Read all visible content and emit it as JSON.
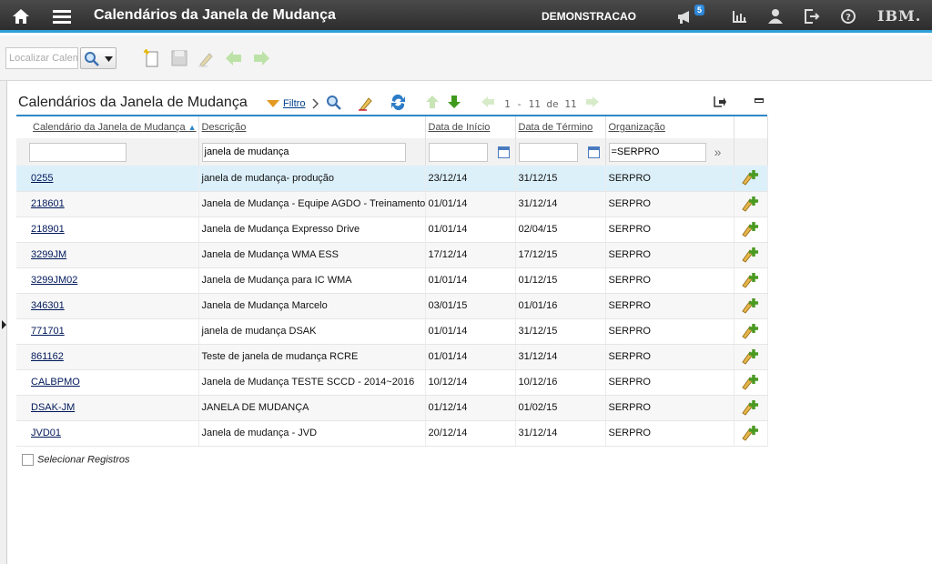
{
  "header": {
    "title": "Calendários da Janela de Mudança",
    "user": "DEMONSTRACAO",
    "notifications": "5",
    "brand": "IBM."
  },
  "toolbar": {
    "find_placeholder": "Localizar Calendário"
  },
  "section": {
    "title": "Calendários da Janela de Mudança",
    "filter_label": "Filtro",
    "pager": "1 - 11 de 11"
  },
  "columns": [
    "Calendário da Janela de Mudança",
    "Descrição",
    "Data de Início",
    "Data de Término",
    "Organização"
  ],
  "filters": {
    "calendar": "",
    "description": "janela de mudança",
    "start": "",
    "end": "",
    "org": "=SERPRO"
  },
  "rows": [
    {
      "code": "0255",
      "desc": "janela de mudança- produção",
      "start": "23/12/14",
      "end": "31/12/15",
      "org": "SERPRO"
    },
    {
      "code": "218601",
      "desc": "Janela de Mudança - Equipe AGDO - Treinamento",
      "start": "01/01/14",
      "end": "31/12/14",
      "org": "SERPRO"
    },
    {
      "code": "218901",
      "desc": "Janela de Mudança Expresso Drive",
      "start": "01/01/14",
      "end": "02/04/15",
      "org": "SERPRO"
    },
    {
      "code": "3299JM",
      "desc": "Janela de Mudança WMA ESS",
      "start": "17/12/14",
      "end": "17/12/15",
      "org": "SERPRO"
    },
    {
      "code": "3299JM02",
      "desc": "Janela de Mudança para IC WMA",
      "start": "01/01/14",
      "end": "01/12/15",
      "org": "SERPRO"
    },
    {
      "code": "346301",
      "desc": "Janela de Mudança Marcelo",
      "start": "03/01/15",
      "end": "01/01/16",
      "org": "SERPRO"
    },
    {
      "code": "771701",
      "desc": "janela de mudança DSAK",
      "start": "01/01/14",
      "end": "31/12/15",
      "org": "SERPRO"
    },
    {
      "code": "861162",
      "desc": "Teste de janela de mudança RCRE",
      "start": "01/01/14",
      "end": "31/12/14",
      "org": "SERPRO"
    },
    {
      "code": "CALBPMO",
      "desc": "Janela de Mudança TESTE SCCD - 2014~2016",
      "start": "10/12/14",
      "end": "10/12/16",
      "org": "SERPRO"
    },
    {
      "code": "DSAK-JM",
      "desc": "JANELA DE MUDANÇA",
      "start": "01/12/14",
      "end": "01/02/15",
      "org": "SERPRO"
    },
    {
      "code": "JVD01",
      "desc": "Janela de mudança - JVD",
      "start": "20/12/14",
      "end": "31/12/14",
      "org": "SERPRO"
    }
  ],
  "footer": {
    "select_records": "Selecionar Registros"
  },
  "colors": {
    "accent": "#2e9fd8",
    "selected_row": "#dcf0fa",
    "add_icon": "#5aa02c"
  }
}
